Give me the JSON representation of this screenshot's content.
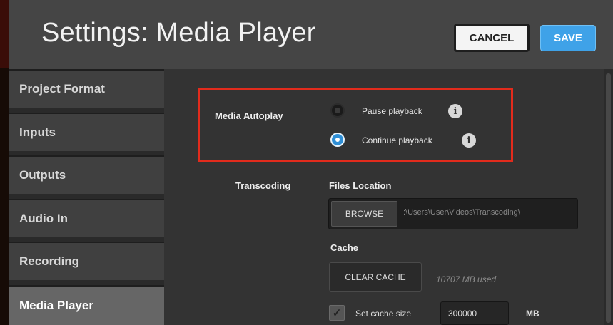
{
  "header": {
    "title": "Settings: Media Player",
    "cancel_label": "CANCEL",
    "save_label": "SAVE"
  },
  "sidebar": {
    "items": [
      {
        "label": "Project Format",
        "active": false
      },
      {
        "label": "Inputs",
        "active": false
      },
      {
        "label": "Outputs",
        "active": false
      },
      {
        "label": "Audio In",
        "active": false
      },
      {
        "label": "Recording",
        "active": false
      },
      {
        "label": "Media Player",
        "active": true
      }
    ]
  },
  "autoplay": {
    "label": "Media Autoplay",
    "options": [
      {
        "label": "Pause playback",
        "selected": false,
        "icon": "info-icon"
      },
      {
        "label": "Continue playback",
        "selected": true,
        "icon": "info-icon"
      }
    ]
  },
  "transcoding": {
    "label": "Transcoding",
    "files_location_label": "Files Location",
    "browse_label": "BROWSE",
    "path": ":\\Users\\User\\Videos\\Transcoding\\",
    "cache_label": "Cache",
    "clear_cache_label": "CLEAR CACHE",
    "used_text": "10707 MB used",
    "set_cache_size_label": "Set cache size",
    "set_cache_size_checked": true,
    "cache_size_value": "300000",
    "cache_unit": "MB"
  },
  "colors": {
    "accent": "#3fa2e8",
    "highlight_border": "#e22b1c",
    "header_bg": "#454545",
    "content_bg": "#333333"
  }
}
